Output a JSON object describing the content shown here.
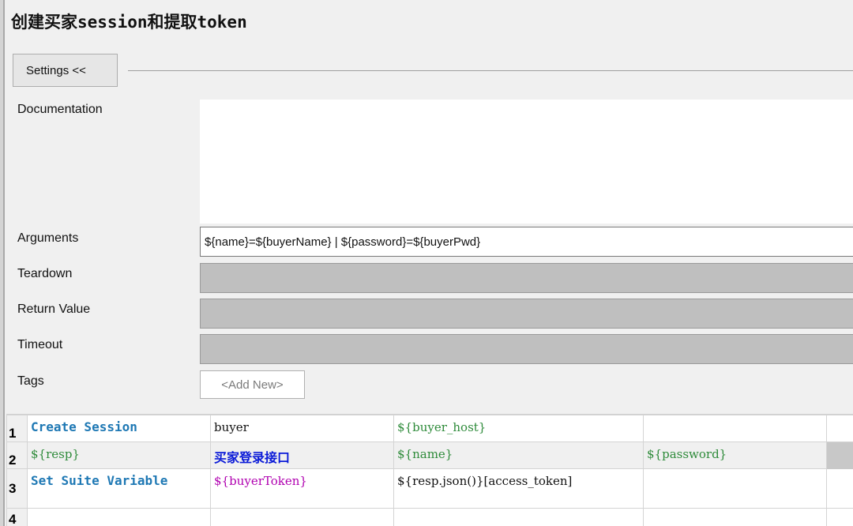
{
  "title": "创建买家session和提取token",
  "settings_button": "Settings <<",
  "labels": {
    "documentation": "Documentation",
    "arguments": "Arguments",
    "teardown": "Teardown",
    "return_value": "Return Value",
    "timeout": "Timeout",
    "tags": "Tags"
  },
  "arguments_value": "${name}=${buyerName} | ${password}=${buyerPwd}",
  "tags_add_new": "<Add New>",
  "grid": {
    "rows": [
      {
        "num": "1",
        "cells": [
          "Create Session",
          "buyer",
          "${buyer_host}",
          "",
          ""
        ]
      },
      {
        "num": "2",
        "cells": [
          "${resp}",
          "买家登录接口",
          "${name}",
          "${password}",
          ""
        ]
      },
      {
        "num": "3",
        "cells": [
          "Set Suite Variable",
          "${buyerToken}",
          "${resp.json()}[access_token]",
          "",
          ""
        ]
      },
      {
        "num": "4",
        "cells": [
          "",
          "",
          "",
          "",
          ""
        ]
      }
    ]
  },
  "colors": {
    "keyword": "#1e78b4",
    "variable": "#2e8b3a",
    "assigned_variable": "#b000b0",
    "cn_keyword": "#0a1ad8",
    "disabled_field": "#bfbfbf"
  }
}
